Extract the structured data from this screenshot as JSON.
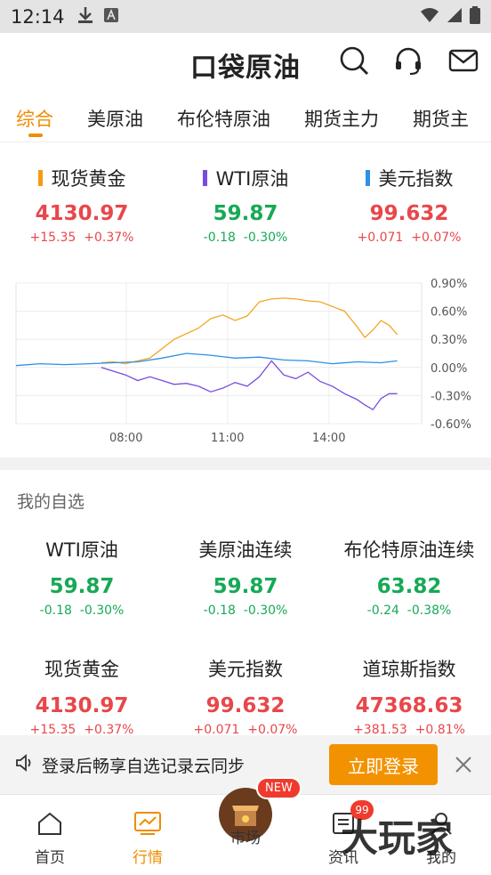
{
  "status_bar": {
    "time": "12:14"
  },
  "header": {
    "logo_text": "口袋原油"
  },
  "tabs": [
    "综合",
    "美原油",
    "布伦特原油",
    "期货主力",
    "期货主"
  ],
  "quotes": [
    {
      "name": "现货黄金",
      "price": "4130.97",
      "change": "+15.35",
      "pct": "+0.37%",
      "marker_color": "#f39c12",
      "dir": "up"
    },
    {
      "name": "WTI原油",
      "price": "59.87",
      "change": "-0.18",
      "pct": "-0.30%",
      "marker_color": "#7a4be0",
      "dir": "down"
    },
    {
      "name": "美元指数",
      "price": "99.632",
      "change": "+0.071",
      "pct": "+0.07%",
      "marker_color": "#2e8fe8",
      "dir": "up"
    }
  ],
  "chart_data": {
    "type": "line",
    "x_ticks": [
      "08:00",
      "11:00",
      "14:00"
    ],
    "y_ticks": [
      "0.90%",
      "0.60%",
      "0.30%",
      "0.00%",
      "-0.30%",
      "-0.60%"
    ],
    "ylim": [
      -0.6,
      0.9
    ],
    "xlim": [
      0,
      100
    ],
    "series": [
      {
        "name": "现货黄金",
        "color": "#f5a623",
        "x": [
          21,
          24,
          27,
          30,
          33,
          36,
          39,
          42,
          45,
          48,
          51,
          54,
          57,
          60,
          63,
          66,
          69,
          72,
          75,
          78,
          81,
          84,
          86,
          88,
          90,
          92,
          94
        ],
        "y": [
          0.05,
          0.06,
          0.04,
          0.07,
          0.1,
          0.2,
          0.3,
          0.36,
          0.42,
          0.52,
          0.56,
          0.5,
          0.55,
          0.7,
          0.73,
          0.74,
          0.73,
          0.71,
          0.7,
          0.65,
          0.6,
          0.44,
          0.32,
          0.4,
          0.5,
          0.45,
          0.35
        ]
      },
      {
        "name": "WTI原油",
        "color": "#7b4be0",
        "x": [
          21,
          24,
          27,
          30,
          33,
          36,
          39,
          42,
          45,
          48,
          51,
          54,
          57,
          60,
          63,
          66,
          69,
          72,
          75,
          78,
          81,
          84,
          86,
          88,
          90,
          92,
          94
        ],
        "y": [
          0.0,
          -0.04,
          -0.08,
          -0.14,
          -0.1,
          -0.14,
          -0.18,
          -0.17,
          -0.2,
          -0.26,
          -0.22,
          -0.16,
          -0.2,
          -0.1,
          0.07,
          -0.08,
          -0.12,
          -0.05,
          -0.15,
          -0.2,
          -0.28,
          -0.34,
          -0.4,
          -0.45,
          -0.33,
          -0.28,
          -0.28
        ]
      },
      {
        "name": "美元指数",
        "color": "#2d8fe6",
        "x": [
          0,
          6,
          12,
          18,
          24,
          30,
          36,
          42,
          48,
          54,
          60,
          66,
          72,
          78,
          84,
          90,
          94
        ],
        "y": [
          0.02,
          0.04,
          0.03,
          0.04,
          0.05,
          0.06,
          0.1,
          0.15,
          0.13,
          0.1,
          0.11,
          0.08,
          0.07,
          0.04,
          0.06,
          0.05,
          0.07
        ]
      }
    ]
  },
  "watchlist": {
    "title": "我的自选",
    "items": [
      {
        "name": "WTI原油",
        "price": "59.87",
        "change": "-0.18",
        "pct": "-0.30%",
        "dir": "down"
      },
      {
        "name": "美原油连续",
        "price": "59.87",
        "change": "-0.18",
        "pct": "-0.30%",
        "dir": "down"
      },
      {
        "name": "布伦特原油连续",
        "price": "63.82",
        "change": "-0.24",
        "pct": "-0.38%",
        "dir": "down"
      },
      {
        "name": "现货黄金",
        "price": "4130.97",
        "change": "+15.35",
        "pct": "+0.37%",
        "dir": "up"
      },
      {
        "name": "美元指数",
        "price": "99.632",
        "change": "+0.071",
        "pct": "+0.07%",
        "dir": "up"
      },
      {
        "name": "道琼斯指数",
        "price": "47368.63",
        "change": "+381.53",
        "pct": "+0.81%",
        "dir": "up"
      }
    ]
  },
  "login_bar": {
    "text": "登录后畅享自选记录云同步",
    "button": "立即登录"
  },
  "bottom_nav": {
    "items": [
      "首页",
      "行情",
      "市场",
      "资讯",
      "我的"
    ],
    "new_badge": "NEW",
    "news_count": "99"
  },
  "watermark": "大玩家",
  "colors": {
    "accent": "#f08c00",
    "up": "#e8474b",
    "down": "#17a956"
  }
}
